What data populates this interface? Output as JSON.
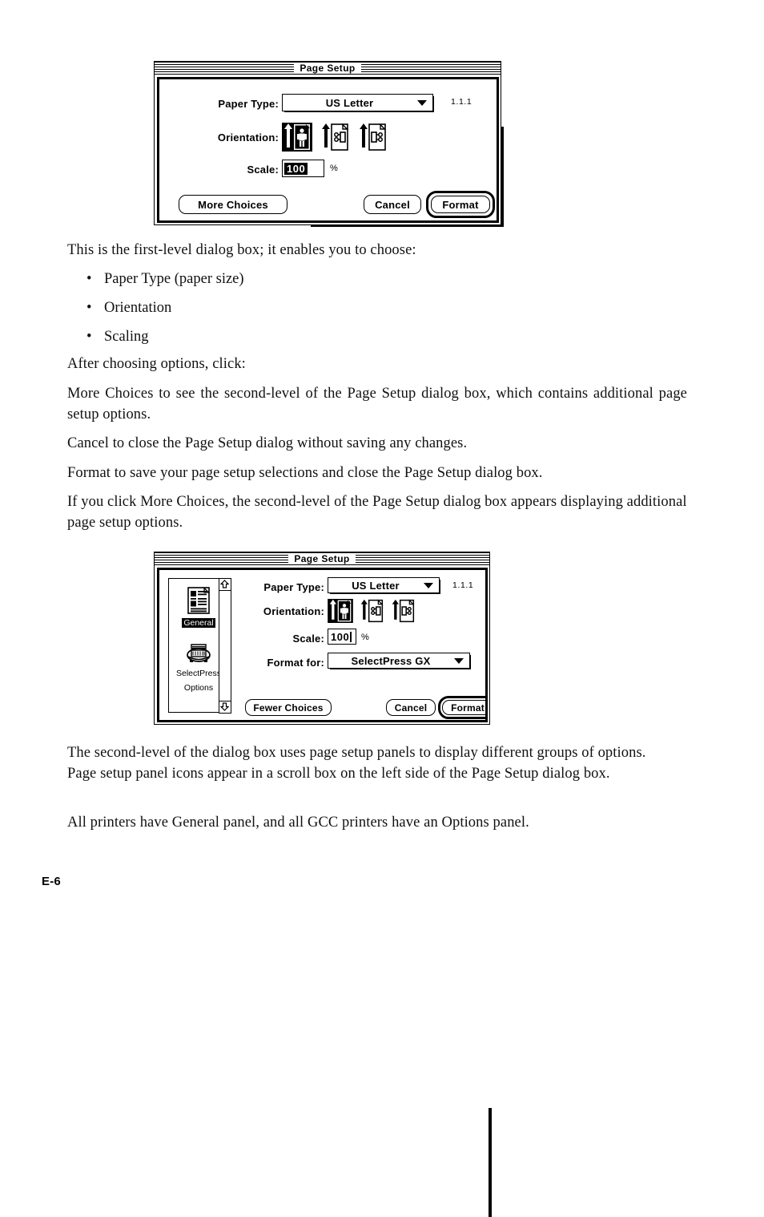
{
  "page": {
    "folio": "E-6"
  },
  "dialog1": {
    "name": "page-setup-first-level",
    "title": "Page Setup",
    "version": "1.1.1",
    "paper_type": {
      "label": "Paper Type:",
      "value": "US Letter"
    },
    "orientation": {
      "label": "Orientation:",
      "options": [
        {
          "name": "portrait",
          "selected": true
        },
        {
          "name": "landscape-left",
          "selected": false
        },
        {
          "name": "landscape-right",
          "selected": false
        }
      ]
    },
    "scale": {
      "label": "Scale:",
      "value": "100",
      "unit": "%"
    },
    "buttons": {
      "more_choices": "More Choices",
      "cancel": "Cancel",
      "format": "Format"
    }
  },
  "body_text": {
    "p1": "This is the first-level dialog box; it enables you to choose:",
    "bullets": [
      "Paper Type (paper size)",
      "Orientation",
      "Scaling"
    ],
    "bullet_char": "•",
    "p2": "After choosing options, click:",
    "p3": "More Choices to see the second-level of the Page Setup dialog box, which contains additional page setup options.",
    "p4": "Cancel to close the Page Setup dialog without saving any changes.",
    "p5": "Format to save your page setup selections and close the Page Setup dialog box.",
    "p6": "If you click More Choices, the second-level of the Page Setup dialog box appears displaying additional page setup options.",
    "p7": "The second-level of the dialog box uses page setup panels to display different groups of options. Page setup panel icons appear in a scroll box on the left side of the Page Setup dialog box.",
    "p8": "All printers have General panel, and all GCC printers have an Options panel."
  },
  "dialog2": {
    "name": "page-setup-second-level",
    "title": "Page Setup",
    "version": "1.1.1",
    "panels": [
      {
        "label": "General",
        "icon": "document-panel-icon",
        "selected": true
      },
      {
        "label": "SelectPress\nOptions",
        "label_line1": "SelectPress",
        "label_line2": "Options",
        "icon": "printer-panel-icon",
        "selected": false
      }
    ],
    "paper_type": {
      "label": "Paper Type:",
      "value": "US Letter"
    },
    "orientation": {
      "label": "Orientation:",
      "options": [
        {
          "name": "portrait",
          "selected": true
        },
        {
          "name": "landscape-left",
          "selected": false
        },
        {
          "name": "landscape-right",
          "selected": false
        }
      ]
    },
    "scale": {
      "label": "Scale:",
      "value": "100",
      "unit": "%"
    },
    "format_for": {
      "label": "Format for:",
      "value": "SelectPress GX"
    },
    "buttons": {
      "fewer_choices": "Fewer Choices",
      "cancel": "Cancel",
      "format": "Format"
    },
    "scrollbar": {
      "up": "⇧",
      "down": "⇩"
    }
  },
  "colors": {
    "ink": "#000000",
    "paper": "#ffffff",
    "body_ink": "#111111"
  }
}
